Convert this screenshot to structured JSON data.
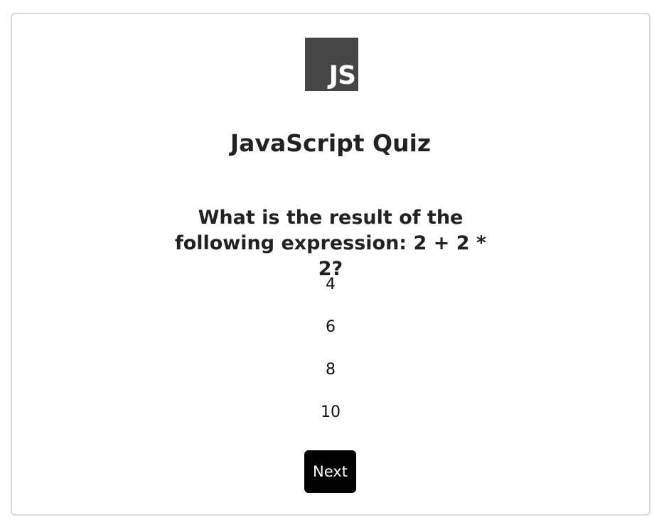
{
  "logo": {
    "text": "JS",
    "background_color": "#454545",
    "text_color": "#ffffff"
  },
  "title": "JavaScript Quiz",
  "question": {
    "text": "What is the result of the following expression: 2 + 2 * 2?"
  },
  "answers": [
    {
      "label": "4"
    },
    {
      "label": "6"
    },
    {
      "label": "8"
    },
    {
      "label": "10"
    }
  ],
  "next_button": {
    "label": "Next",
    "background_color": "#000000",
    "text_color": "#ffffff"
  }
}
